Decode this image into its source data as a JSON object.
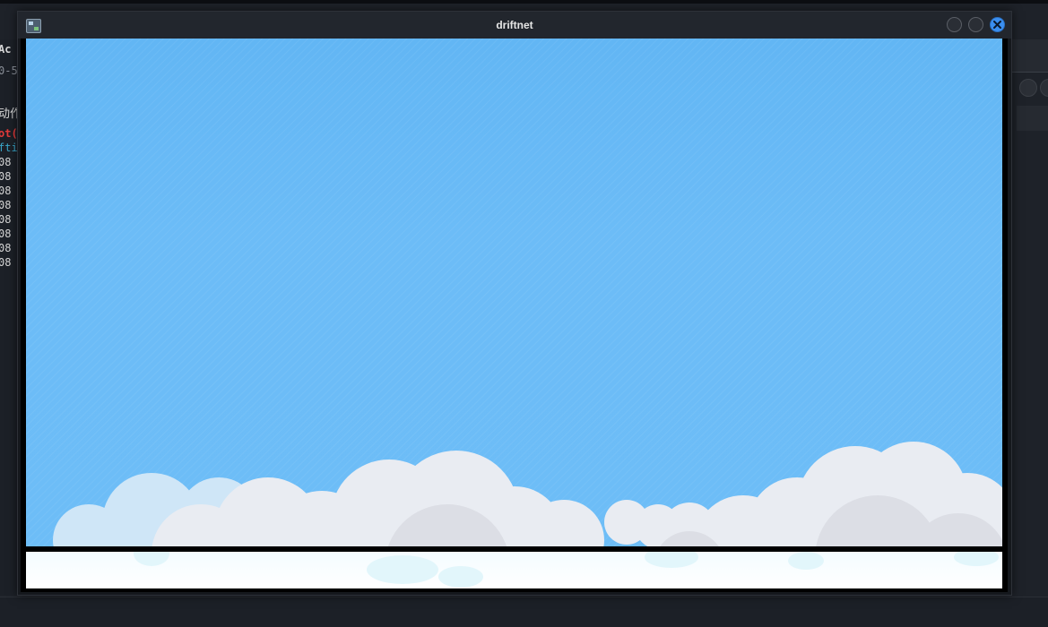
{
  "window": {
    "title": "driftnet",
    "close_label": "×"
  },
  "background_terminal": {
    "title_fragment": "Ac",
    "lines": [
      "0-5",
      "动作",
      "ot(",
      "fti",
      "08",
      "08",
      "08",
      "08",
      "08",
      "08",
      "08",
      "08"
    ]
  },
  "images": [
    {
      "icon": "sky-with-clouds-image"
    },
    {
      "icon": "light-sky-image"
    }
  ],
  "colors": {
    "sky": "#6cbcf7",
    "cloud": "#e8eaef",
    "close_button": "#3b8ff0"
  }
}
